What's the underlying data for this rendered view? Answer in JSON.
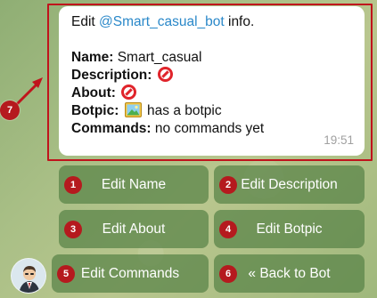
{
  "message": {
    "intro_prefix": "Edit ",
    "mention": "@Smart_casual_bot",
    "intro_suffix": " info.",
    "name_label": "Name:",
    "name_value": "Smart_casual",
    "description_label": "Description:",
    "about_label": "About:",
    "botpic_label": "Botpic:",
    "botpic_value": "has a botpic",
    "commands_label": "Commands:",
    "commands_value": "no commands yet",
    "time": "19:51"
  },
  "annotation": {
    "label": "7",
    "color": "#c0141c"
  },
  "buttons": [
    {
      "label": "Edit Name",
      "badge": "1"
    },
    {
      "label": "Edit Description",
      "badge": "2"
    },
    {
      "label": "Edit About",
      "badge": "3"
    },
    {
      "label": "Edit Botpic",
      "badge": "4"
    },
    {
      "label": "Edit Commands",
      "badge": "5"
    },
    {
      "label": "« Back to Bot",
      "badge": "6"
    }
  ],
  "icons": {
    "description_status": "no-entry-icon",
    "about_status": "no-entry-icon",
    "botpic_status": "picture-icon",
    "avatar": "bot-avatar"
  },
  "colors": {
    "mention": "#2a88c9",
    "badge": "#b51a1e",
    "button_bg": "#588246",
    "no_entry": "#e0242b"
  }
}
